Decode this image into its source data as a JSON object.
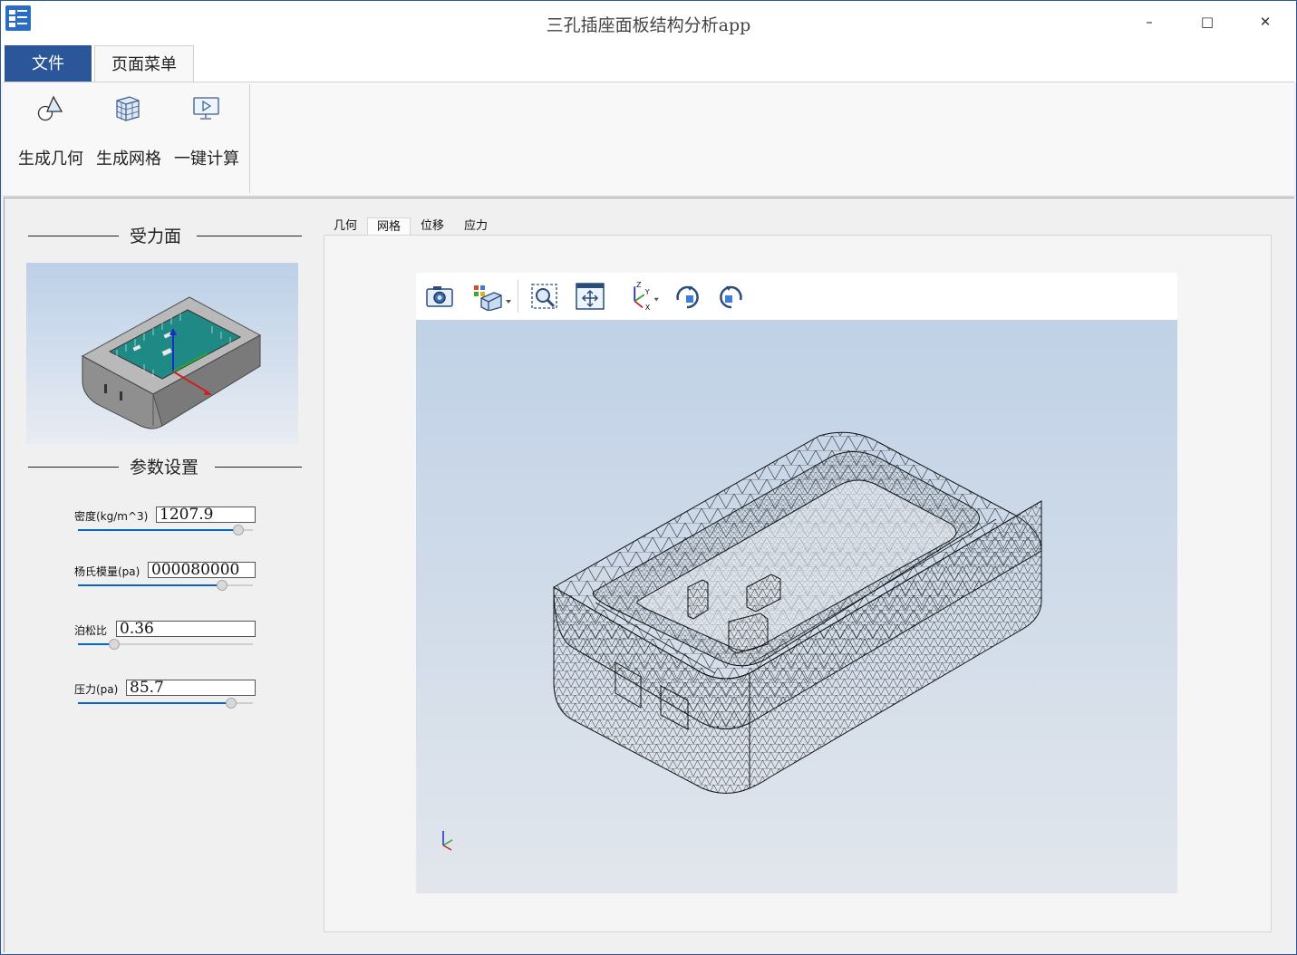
{
  "window": {
    "title": "三孔插座面板结构分析app",
    "minimize": "–",
    "maximize": "□",
    "close": "✕"
  },
  "ribbon": {
    "tabs": [
      {
        "label": "文件",
        "active": false
      },
      {
        "label": "页面菜单",
        "active": true
      }
    ],
    "buttons": [
      {
        "label": "生成几何",
        "icon": "geometry-icon"
      },
      {
        "label": "生成网格",
        "icon": "mesh-cube-icon"
      },
      {
        "label": "一键计算",
        "icon": "monitor-play-icon"
      }
    ]
  },
  "left_panel": {
    "force_face_title": "受力面",
    "params_title": "参数设置",
    "params": [
      {
        "label": "密度(kg/m^3)",
        "value": "1207.9",
        "slider_fraction": 0.91
      },
      {
        "label": "杨氏模量(pa)",
        "value": "000080000",
        "slider_fraction": 0.82
      },
      {
        "label": "泊松比",
        "value": "0.36",
        "slider_fraction": 0.2
      },
      {
        "label": "压力(pa)",
        "value": "85.7",
        "slider_fraction": 0.87
      }
    ]
  },
  "view_tabs": [
    {
      "label": "几何",
      "active": false
    },
    {
      "label": "网格",
      "active": true
    },
    {
      "label": "位移",
      "active": false
    },
    {
      "label": "应力",
      "active": false
    }
  ],
  "viewer_toolbar": [
    {
      "icon": "camera-icon"
    },
    {
      "icon": "view-cube-icon"
    },
    {
      "icon": "zoom-box-icon"
    },
    {
      "icon": "fit-all-icon"
    },
    {
      "icon": "axis-xyz-icon"
    },
    {
      "icon": "rotate-cw-icon"
    },
    {
      "icon": "rotate-ccw-icon"
    }
  ],
  "axis_labels": {
    "x": "X",
    "y": "Y",
    "z": "Z"
  },
  "colors": {
    "accent": "#2b579a",
    "slider_fill": "#0a63c4",
    "model_gray": "#8a8a8a",
    "panel_teal": "#1f8a85"
  }
}
